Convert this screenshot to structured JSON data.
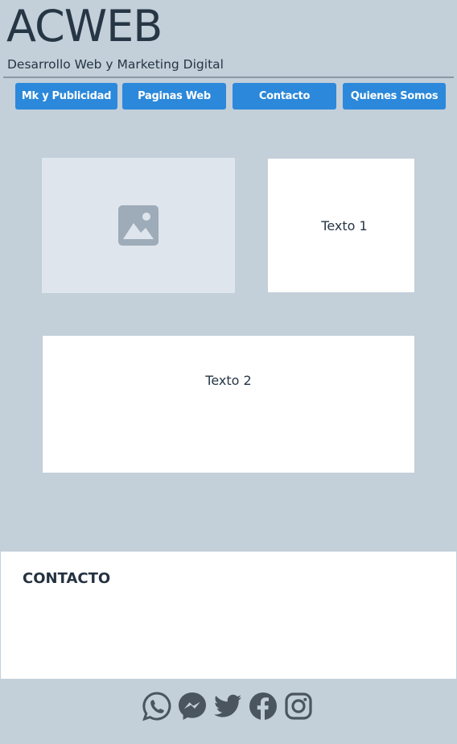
{
  "header": {
    "title": "ACWEB",
    "subtitle": "Desarrollo Web y Marketing Digital"
  },
  "nav": {
    "items": [
      {
        "label": "Mk y Publicidad"
      },
      {
        "label": "Paginas Web"
      },
      {
        "label": "Contacto"
      },
      {
        "label": "Quienes Somos"
      }
    ]
  },
  "main": {
    "image_icon": "image-placeholder-icon",
    "text1": "Texto 1",
    "text2": "Texto 2"
  },
  "contact": {
    "title": "CONTACTO"
  },
  "social": {
    "icons": [
      "whatsapp-icon",
      "messenger-icon",
      "twitter-icon",
      "facebook-icon",
      "instagram-icon"
    ]
  },
  "colors": {
    "background": "#c3cfd9",
    "accent": "#2b88da",
    "text": "#263645",
    "icon": "#4a5560"
  }
}
